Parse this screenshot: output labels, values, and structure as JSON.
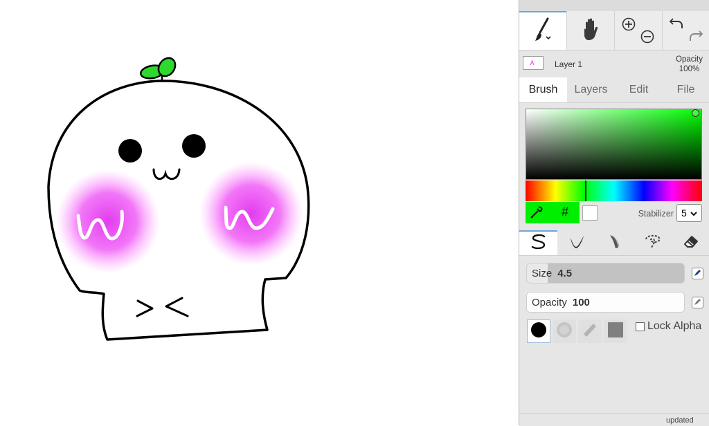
{
  "canvas": {
    "drawing_name": "kawaii-skull-drawing"
  },
  "toolbar": {
    "tools": [
      {
        "name": "brush-tool",
        "icon": "paintbrush-icon",
        "active": true
      },
      {
        "name": "hand-tool",
        "icon": "hand-icon",
        "active": false
      },
      {
        "name": "zoom-in",
        "icon": "zoom-in-icon"
      },
      {
        "name": "zoom-out",
        "icon": "zoom-out-icon"
      },
      {
        "name": "undo",
        "icon": "undo-icon"
      },
      {
        "name": "redo",
        "icon": "redo-icon"
      }
    ]
  },
  "layer": {
    "name": "Layer 1",
    "opacity_label": "Opacity",
    "opacity_value": "100%"
  },
  "tabs": [
    {
      "label": "Brush",
      "active": true
    },
    {
      "label": "Layers",
      "active": false
    },
    {
      "label": "Edit",
      "active": false
    },
    {
      "label": "File",
      "active": false
    }
  ],
  "color": {
    "primary": "#00ee00",
    "secondary": "#ffffff",
    "hash_symbol": "#",
    "hue_position": 0.33
  },
  "stabilizer": {
    "label": "Stabilizer",
    "value": "5"
  },
  "brush_types": [
    {
      "name": "pen",
      "icon": "pen-stroke-icon",
      "active": true
    },
    {
      "name": "ink",
      "icon": "ink-brush-icon",
      "active": false
    },
    {
      "name": "blend",
      "icon": "blend-brush-icon",
      "active": false
    },
    {
      "name": "lasso",
      "icon": "lasso-icon",
      "active": false
    },
    {
      "name": "eraser",
      "icon": "eraser-icon",
      "active": false
    }
  ],
  "brush": {
    "size_label": "Size",
    "size_value": "4.5",
    "size_fraction": 0.13,
    "opacity_label": "Opacity",
    "opacity_value": "100",
    "opacity_fraction": 1.0
  },
  "tips": [
    {
      "name": "round-tip",
      "active": true
    },
    {
      "name": "soft-tip",
      "active": false
    },
    {
      "name": "slanted-tip",
      "active": false
    },
    {
      "name": "square-tip",
      "active": false
    }
  ],
  "lock_alpha": {
    "label": "Lock Alpha",
    "checked": false
  },
  "bottom": {
    "updated_label": "updated"
  }
}
